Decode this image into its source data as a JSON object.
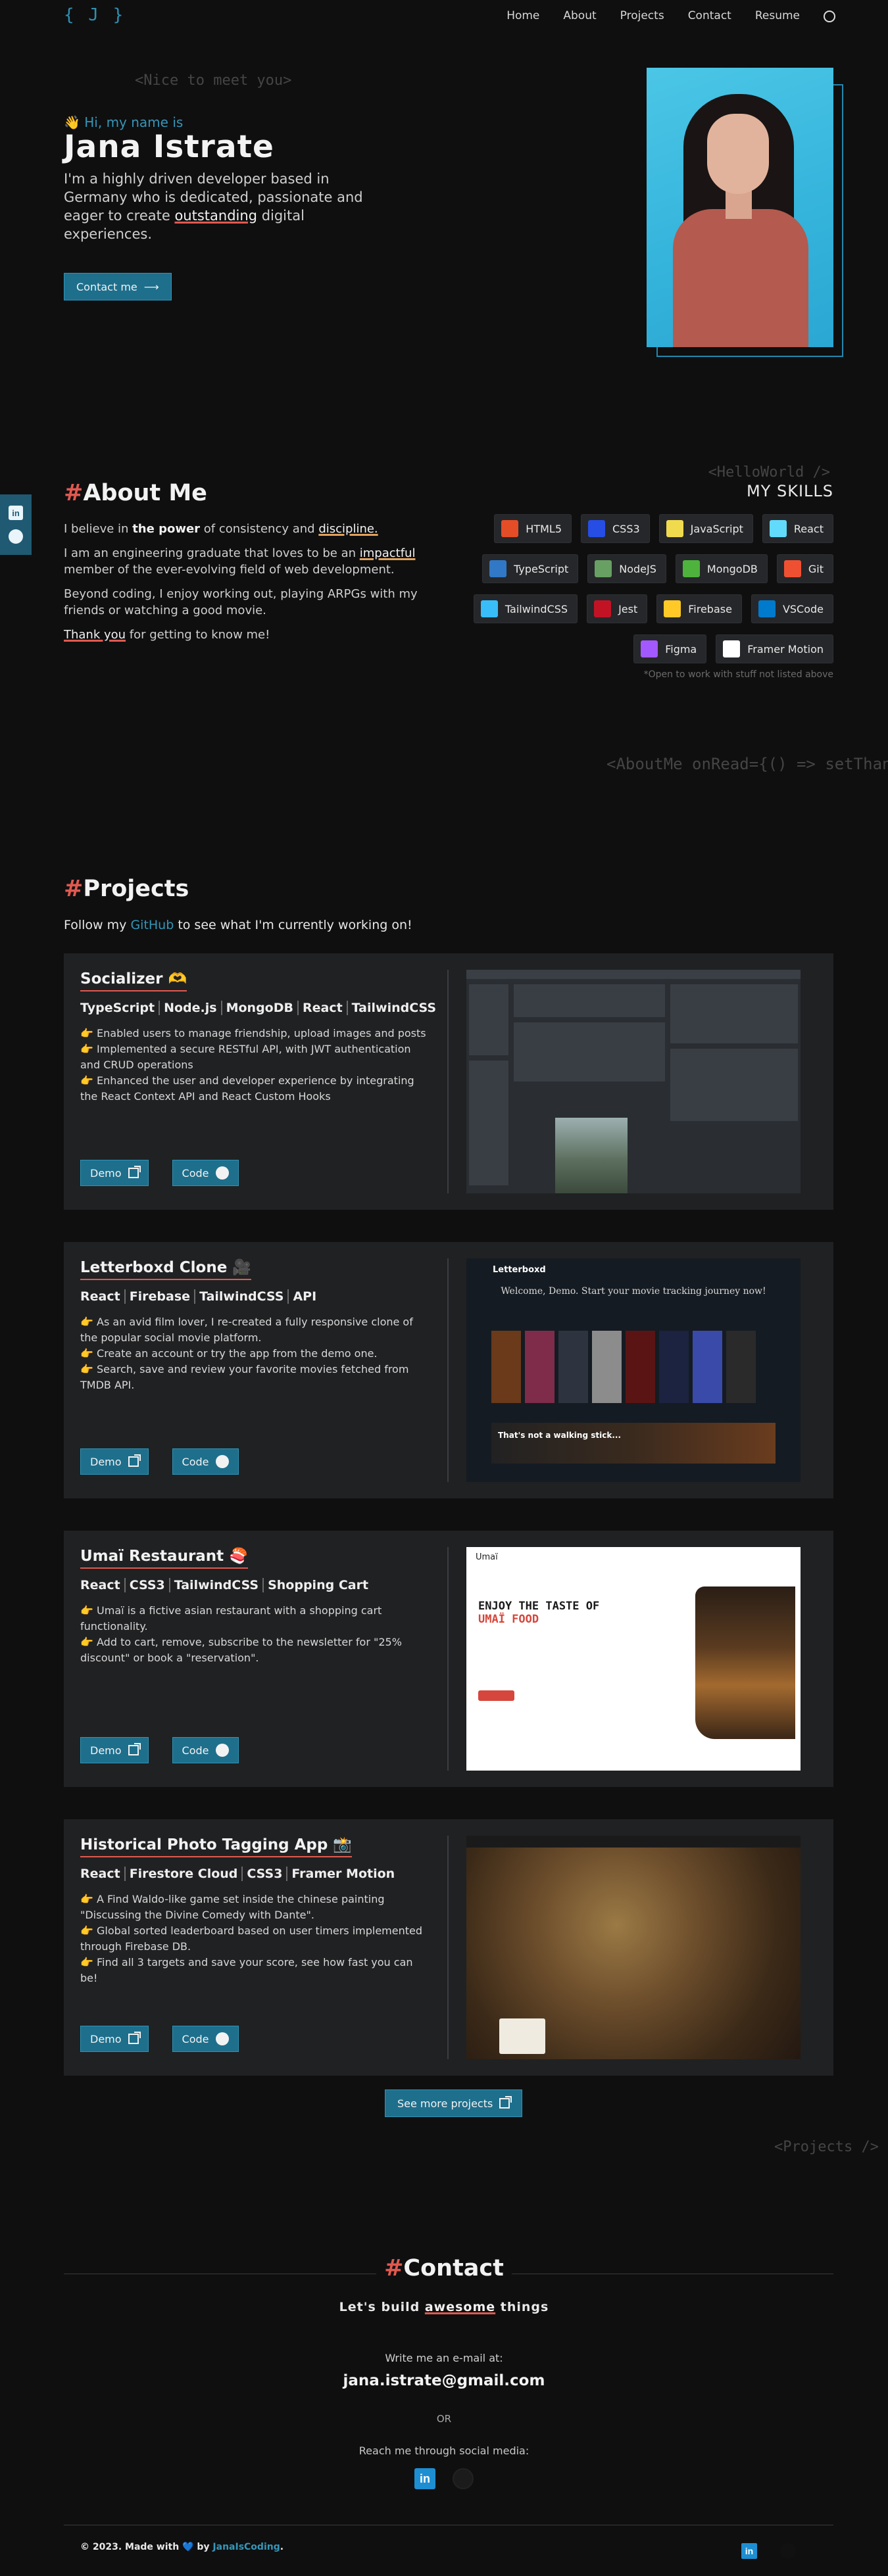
{
  "header": {
    "logo": "{ J }",
    "nav": [
      "Home",
      "About",
      "Projects",
      "Contact",
      "Resume"
    ]
  },
  "side_social": {
    "linkedin": "in"
  },
  "hero": {
    "tag": "<Nice to meet you>",
    "greeting": "👋 Hi, my name is",
    "name": "Jana Istrate",
    "desc_1": "I'm a highly driven developer based in Germany who is dedicated, passionate and eager to create ",
    "desc_em": "outstanding",
    "desc_2": " digital experiences.",
    "cta": "Contact me"
  },
  "about": {
    "title": "About Me",
    "p1_a": "I believe in ",
    "p1_b": "the power",
    "p1_c": " of consistency and ",
    "p1_d": "discipline.",
    "p2_a": "I am an engineering graduate that loves to be an ",
    "p2_b": "impactful",
    "p2_c": " member of the ever-evolving field of web development.",
    "p3": "Beyond coding, I enjoy working out, playing ARPGs with my friends or watching a good movie.",
    "p4_a": "Thank you",
    "p4_b": " for getting to know me!",
    "hello_tag": "<HelloWorld />",
    "skills_title": "MY SKILLS",
    "skills": [
      {
        "name": "HTML5",
        "icon": "html5-icon",
        "color": "#e44d26"
      },
      {
        "name": "CSS3",
        "icon": "css3-icon",
        "color": "#264de4"
      },
      {
        "name": "JavaScript",
        "icon": "javascript-icon",
        "color": "#f0db4f"
      },
      {
        "name": "React",
        "icon": "react-icon",
        "color": "#61dafb"
      },
      {
        "name": "TypeScript",
        "icon": "typescript-icon",
        "color": "#3178c6"
      },
      {
        "name": "NodeJS",
        "icon": "nodejs-icon",
        "color": "#68a063"
      },
      {
        "name": "MongoDB",
        "icon": "mongodb-icon",
        "color": "#4db33d"
      },
      {
        "name": "Git",
        "icon": "git-icon",
        "color": "#f05032"
      },
      {
        "name": "TailwindCSS",
        "icon": "tailwindcss-icon",
        "color": "#38bdf8"
      },
      {
        "name": "Jest",
        "icon": "jest-icon",
        "color": "#c21325"
      },
      {
        "name": "Firebase",
        "icon": "firebase-icon",
        "color": "#ffca28"
      },
      {
        "name": "VSCode",
        "icon": "vscode-icon",
        "color": "#007acc"
      },
      {
        "name": "Figma",
        "icon": "figma-icon",
        "color": "#a259ff"
      },
      {
        "name": "Framer Motion",
        "icon": "framer-icon",
        "color": "#ffffff"
      }
    ],
    "skills_note": "*Open to work with stuff not listed above",
    "aboutme_tag": "<AboutMe onRead={() => setThankful"
  },
  "projects": {
    "title": "Projects",
    "follow_a": "Follow my ",
    "follow_link": "GitHub",
    "follow_b": " to see what I'm currently working on!",
    "items": [
      {
        "title": "Socializer 🫶",
        "stack": [
          "TypeScript",
          "Node.js",
          "MongoDB",
          "React",
          "TailwindCSS"
        ],
        "bullets": [
          "Enabled users to manage friendship, upload images and posts",
          "Implemented a secure RESTful API, with JWT authentication and CRUD operations",
          "Enhanced the user and developer experience by integrating the React Context API and React Custom Hooks"
        ],
        "demo": "Demo",
        "code": "Code"
      },
      {
        "title": "Letterboxd Clone 🎥",
        "stack": [
          "React",
          "Firebase",
          "TailwindCSS",
          "API"
        ],
        "bullets": [
          "As an avid film lover, I re-created a fully responsive clone of the popular social movie platform.",
          "Create an account or try the app from the demo one.",
          "Search, save and review your favorite movies fetched from TMDB API."
        ],
        "demo": "Demo",
        "code": "Code",
        "shot_logo": "Letterboxd",
        "shot_title": "Welcome, Demo. Start your movie tracking journey now!",
        "shot_banner": "That's not a walking stick..."
      },
      {
        "title": "Umaï Restaurant 🍣",
        "stack": [
          "React",
          "CSS3",
          "TailwindCSS",
          "Shopping Cart"
        ],
        "bullets": [
          "Umaï is a fictive asian restaurant with a shopping cart functionality.",
          "Add to cart, remove, subscribe to the newsletter for \"25% discount\" or book a \"reservation\"."
        ],
        "demo": "Demo",
        "code": "Code",
        "shot_logo": "Umaï",
        "shot_head_1": "ENJOY THE TASTE OF",
        "shot_head_2": "UMAÏ FOOD"
      },
      {
        "title": "Historical Photo Tagging App 📸",
        "stack": [
          "React",
          "Firestore Cloud",
          "CSS3",
          "Framer Motion"
        ],
        "bullets": [
          "A Find Waldo-like game set inside the chinese painting \"Discussing the Divine Comedy with Dante\".",
          "Global sorted leaderboard based on user timers implemented through Firebase DB.",
          "Find all 3 targets and save your score, see how fast you can be!"
        ],
        "demo": "Demo",
        "code": "Code"
      }
    ],
    "see_more": "See more projects",
    "end_tag": "<Projects />"
  },
  "contact": {
    "title": "Contact",
    "build_a": "Let's build ",
    "build_em": "awesome",
    "build_b": " things",
    "write": "Write me an e-mail at:",
    "email": "jana.istrate@gmail.com",
    "or": "OR",
    "reach": "Reach me through social media:"
  },
  "footer": {
    "text_a": "© 2023. Made with ",
    "heart": "💙",
    "text_b": " by ",
    "handle": "JanaIsCoding",
    "text_c": "."
  }
}
